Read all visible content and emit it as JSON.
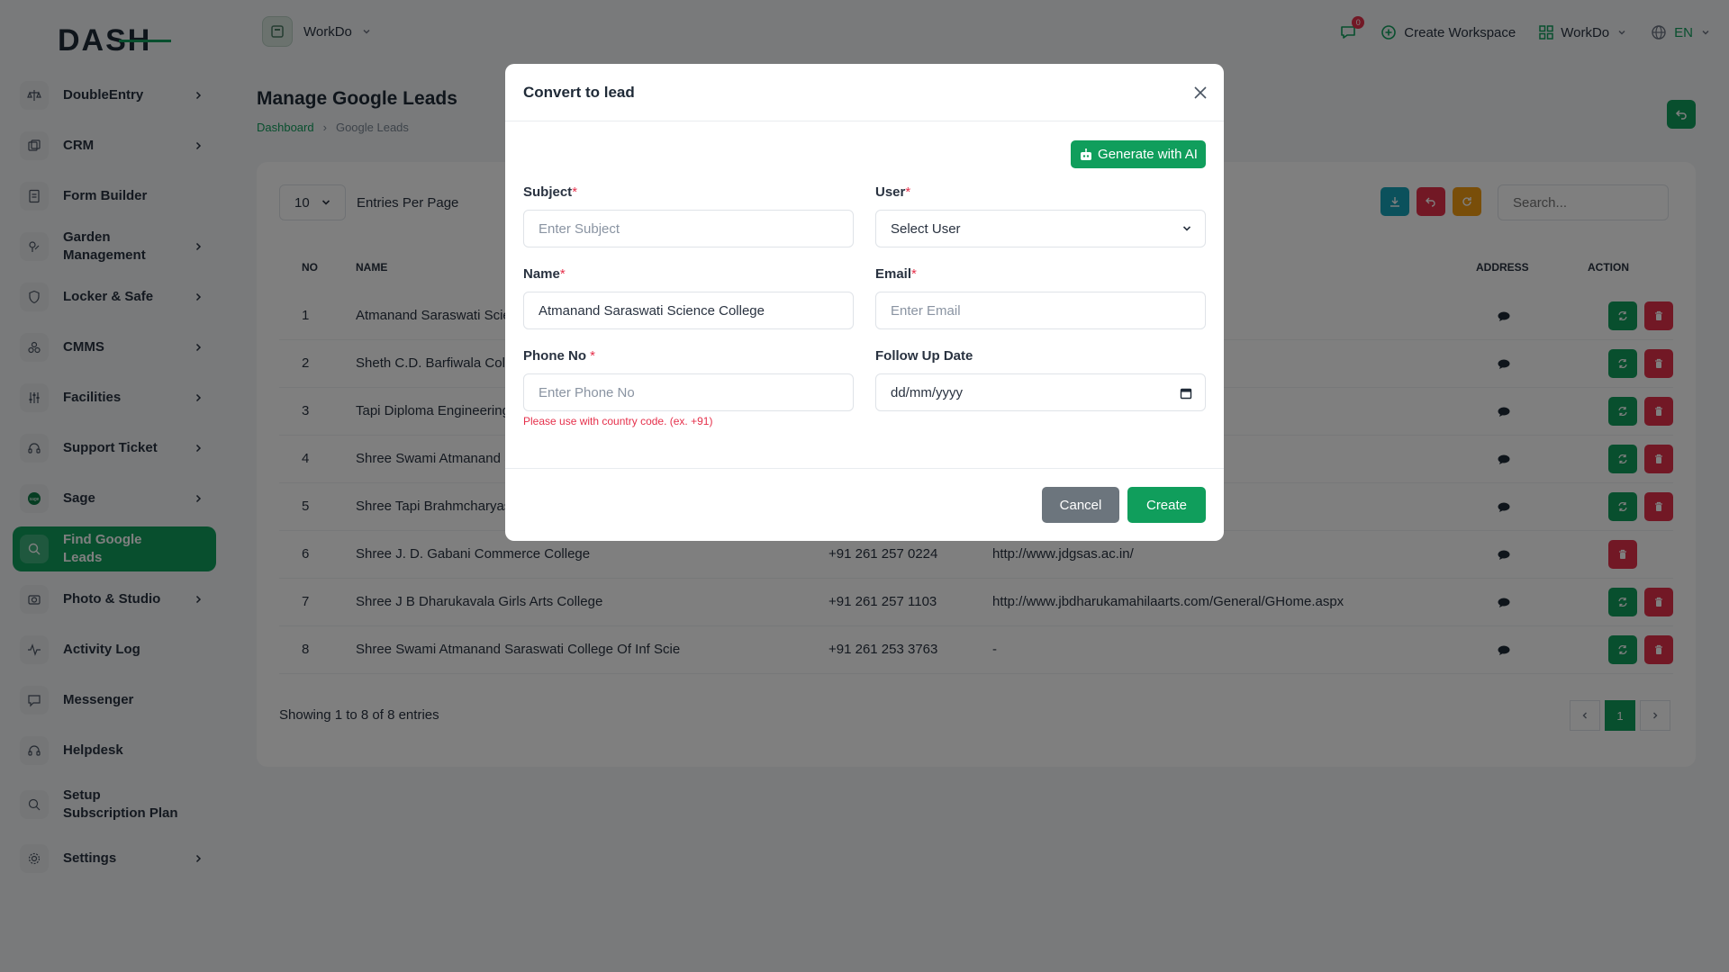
{
  "brand": {
    "logo_text": "DASH",
    "accent": "#109e5c",
    "danger": "#e5304b"
  },
  "sidebar": {
    "items": [
      {
        "label": "DoubleEntry",
        "icon": "scale-icon",
        "chevron": true
      },
      {
        "label": "CRM",
        "icon": "crm-icon",
        "chevron": true
      },
      {
        "label": "Form Builder",
        "icon": "form-icon",
        "chevron": false
      },
      {
        "label": "Garden Management",
        "icon": "garden-icon",
        "chevron": true
      },
      {
        "label": "Locker & Safe",
        "icon": "shield-icon",
        "chevron": true
      },
      {
        "label": "CMMS",
        "icon": "cmms-icon",
        "chevron": true
      },
      {
        "label": "Facilities",
        "icon": "sliders-icon",
        "chevron": true
      },
      {
        "label": "Support Ticket",
        "icon": "headset-icon",
        "chevron": true
      },
      {
        "label": "Sage",
        "icon": "sage-icon",
        "chevron": true
      },
      {
        "label": "Find Google Leads",
        "icon": "search-icon",
        "chevron": false,
        "active": true
      },
      {
        "label": "Photo & Studio",
        "icon": "camera-icon",
        "chevron": true
      },
      {
        "label": "Activity Log",
        "icon": "activity-icon",
        "chevron": false
      },
      {
        "label": "Messenger",
        "icon": "chat-icon",
        "chevron": false
      },
      {
        "label": "Helpdesk",
        "icon": "headset-icon",
        "chevron": false
      },
      {
        "label": "Setup Subscription Plan",
        "icon": "search-plan-icon",
        "chevron": false
      },
      {
        "label": "Settings",
        "icon": "gear-icon",
        "chevron": true
      }
    ]
  },
  "header": {
    "workspace": "WorkDo",
    "notif_count": "0",
    "create_workspace": "Create Workspace",
    "workspace_switch": "WorkDo",
    "lang": "EN"
  },
  "page": {
    "title": "Manage Google Leads",
    "breadcrumb": [
      "Dashboard",
      "Google Leads"
    ]
  },
  "table": {
    "entries_value": "10",
    "entries_label": "Entries Per Page",
    "search_placeholder": "Search...",
    "headers": {
      "no": "NO",
      "name": "NAME",
      "address": "ADDRESS",
      "action": "ACTION"
    },
    "rows": [
      {
        "no": "1",
        "name": "Atmanand Saraswati Scie",
        "phone": "",
        "website": "",
        "convert": true
      },
      {
        "no": "2",
        "name": "Sheth C.D. Barfiwala Colle",
        "phone": "",
        "website": "",
        "convert": true
      },
      {
        "no": "3",
        "name": "Tapi Diploma Engineering",
        "phone": "",
        "website": "",
        "convert": true
      },
      {
        "no": "4",
        "name": "Shree Swami Atmanand S",
        "phone": "",
        "website": "",
        "convert": true
      },
      {
        "no": "5",
        "name": "Shree Tapi Brahmcharyas",
        "phone": "",
        "website": "",
        "convert": true
      },
      {
        "no": "6",
        "name": "Shree J. D. Gabani Commerce College",
        "phone": "+91 261 257 0224",
        "website": "http://www.jdgsas.ac.in/",
        "convert": false
      },
      {
        "no": "7",
        "name": "Shree J B Dharukavala Girls Arts College",
        "phone": "+91 261 257 1103",
        "website": "http://www.jbdharukamahilaarts.com/General/GHome.aspx",
        "convert": true
      },
      {
        "no": "8",
        "name": "Shree Swami Atmanand Saraswati College Of Inf Scie",
        "phone": "+91 261 253 3763",
        "website": "-",
        "convert": true
      }
    ],
    "showing": "Showing 1 to 8 of 8 entries",
    "current_page": "1"
  },
  "modal": {
    "title": "Convert to lead",
    "ai_button": "Generate with AI",
    "subject_label": "Subject",
    "subject_placeholder": "Enter Subject",
    "user_label": "User",
    "user_value": "Select User",
    "name_label": "Name",
    "name_value": "Atmanand Saraswati Science College",
    "email_label": "Email",
    "email_placeholder": "Enter Email",
    "phone_label": "Phone No",
    "phone_placeholder": "Enter Phone No",
    "phone_hint": "Please use with country code. (ex. +91)",
    "followup_label": "Follow Up Date",
    "followup_placeholder": "dd/mm/yyyy",
    "required_mark": "*",
    "cancel": "Cancel",
    "create": "Create"
  }
}
